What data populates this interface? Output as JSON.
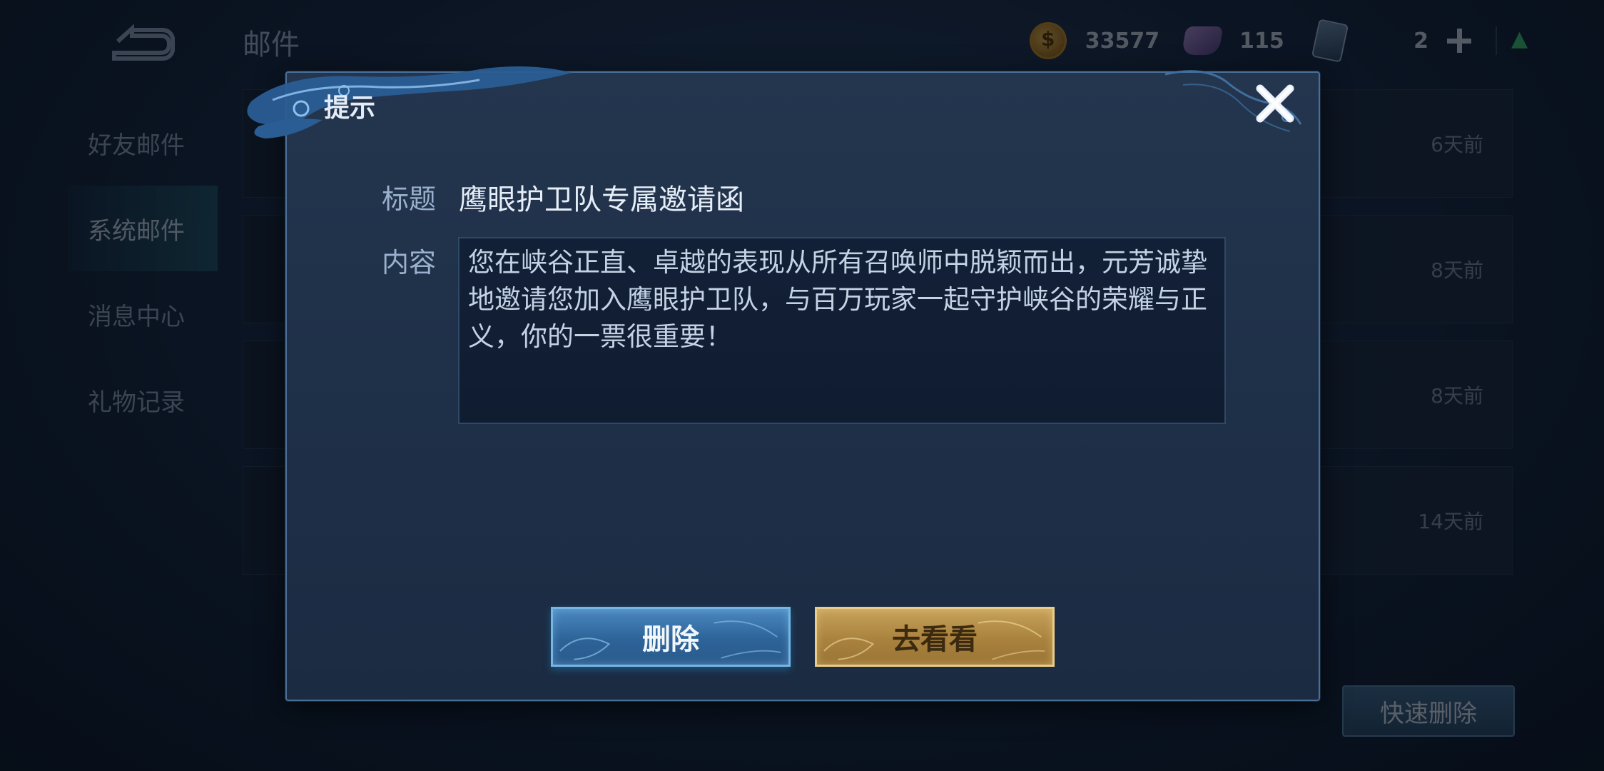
{
  "header": {
    "page_title": "邮件",
    "coins": "33577",
    "gems": "115",
    "cards": "2"
  },
  "sidebar": {
    "items": [
      {
        "label": "好友邮件"
      },
      {
        "label": "系统邮件"
      },
      {
        "label": "消息中心"
      },
      {
        "label": "礼物记录"
      }
    ],
    "active_index": 1
  },
  "mail_list": {
    "rows": [
      {
        "time": "6天前"
      },
      {
        "time": "8天前"
      },
      {
        "time": "8天前"
      },
      {
        "time": "14天前"
      }
    ],
    "quick_delete_label": "快速删除"
  },
  "dialog": {
    "title": "提示",
    "subject_label": "标题",
    "subject_value": "鹰眼护卫队专属邀请函",
    "content_label": "内容",
    "content_lines": [
      "您在峡谷正直、卓越的表现从所有召唤师中脱颖而出，元芳诚挚",
      "地邀请您加入鹰眼护卫队，与百万玩家一起守护峡谷的荣耀与正",
      "义，你的一票很重要！"
    ],
    "delete_label": "删除",
    "view_label": "去看看"
  },
  "colors": {
    "accent_blue": "#4a88c0",
    "accent_gold": "#c7a25a",
    "dialog_bg": "#22334c"
  }
}
